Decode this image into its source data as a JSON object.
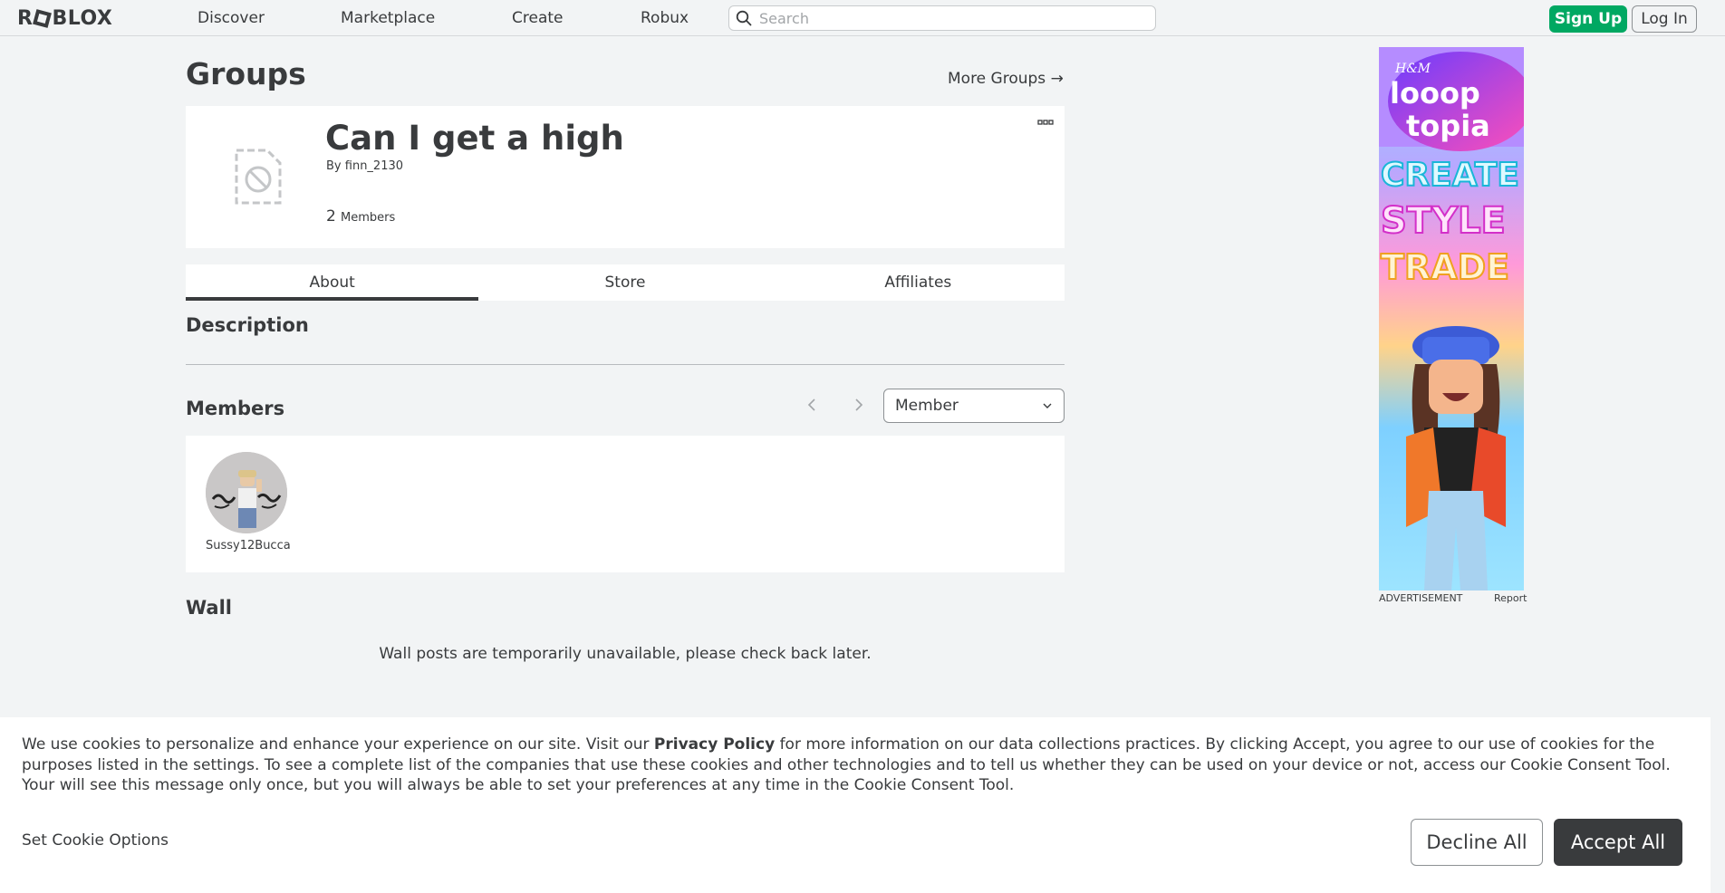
{
  "header": {
    "logo": "ROBLOX",
    "nav": [
      "Discover",
      "Marketplace",
      "Create",
      "Robux"
    ],
    "search_placeholder": "Search",
    "signup_label": "Sign Up",
    "login_label": "Log In"
  },
  "page": {
    "title": "Groups",
    "more_groups": "More Groups →"
  },
  "group": {
    "name": "Can I get a high",
    "owner_prefix": "By",
    "owner": "finn_2130",
    "member_count": "2",
    "member_label": "Members"
  },
  "tabs": [
    {
      "label": "About",
      "active": true
    },
    {
      "label": "Store",
      "active": false
    },
    {
      "label": "Affiliates",
      "active": false
    }
  ],
  "about": {
    "description_title": "Description",
    "members_title": "Members",
    "role_selected": "Member",
    "members": [
      {
        "name": "Sussy12Bucca"
      }
    ],
    "wall_title": "Wall",
    "wall_message": "Wall posts are temporarily unavailable, please check back later."
  },
  "ad": {
    "label": "ADVERTISEMENT",
    "report": "Report",
    "brand": "H&M",
    "headline_1": "looop",
    "headline_2": "topia",
    "words": [
      "CREATE",
      "STYLE",
      "TRADE"
    ]
  },
  "cookie": {
    "text_before": "We use cookies to personalize and enhance your experience on our site. Visit our ",
    "link": "Privacy Policy",
    "text_after": " for more information on our data collections practices. By clicking Accept, you agree to our use of cookies for the purposes listed in the settings. To see a complete list of the companies that use these cookies and other technologies and to tell us whether they can be used on your device or not, access our Cookie Consent Tool. Your will see this message only once, but you will always be able to set your preferences at any time in the Cookie Consent Tool.",
    "options_label": "Set Cookie Options",
    "decline_label": "Decline All",
    "accept_label": "Accept All"
  },
  "colors": {
    "background": "#f2f4f5",
    "text": "#393b3d",
    "signup_green": "#00a862",
    "accept_dark": "#393b3d"
  }
}
